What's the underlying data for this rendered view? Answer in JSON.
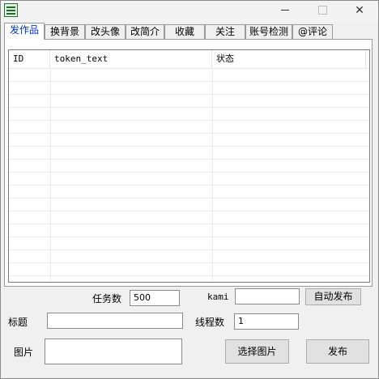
{
  "window": {
    "title": ""
  },
  "tabs": [
    {
      "label": "发作品",
      "active": true
    },
    {
      "label": "换背景"
    },
    {
      "label": "改头像"
    },
    {
      "label": "改简介"
    },
    {
      "label": "收藏"
    },
    {
      "label": "关注"
    },
    {
      "label": "账号检测"
    },
    {
      "label": "@评论"
    }
  ],
  "table": {
    "columns": [
      "ID",
      "token_text",
      "状态"
    ],
    "rows": []
  },
  "form": {
    "task_count_label": "任务数",
    "task_count_value": "500",
    "kami_label": "kami",
    "kami_value": "",
    "auto_publish_label": "自动发布",
    "title_label": "标题",
    "title_value": "",
    "thread_count_label": "线程数",
    "thread_count_value": "1",
    "image_label": "图片",
    "image_value": "",
    "select_image_label": "选择图片",
    "publish_label": "发布"
  },
  "icons": {
    "app": "app-icon",
    "minimize": "minimize-icon",
    "maximize": "maximize-icon",
    "close": "close-icon"
  }
}
